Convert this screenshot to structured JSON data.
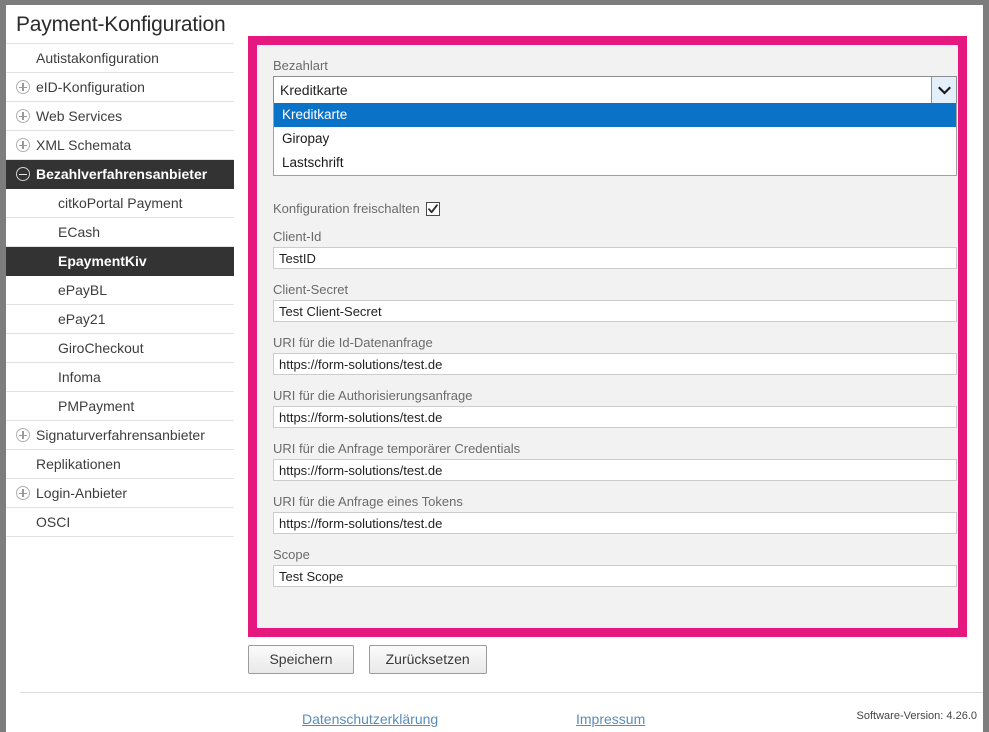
{
  "page": {
    "title": "Payment-Konfiguration"
  },
  "sidebar": {
    "items": [
      {
        "label": "Autistakonfiguration",
        "level": 0,
        "toggle": "none",
        "selected": false
      },
      {
        "label": "eID-Konfiguration",
        "level": 0,
        "toggle": "plus",
        "selected": false
      },
      {
        "label": "Web Services",
        "level": 0,
        "toggle": "plus",
        "selected": false
      },
      {
        "label": "XML Schemata",
        "level": 0,
        "toggle": "plus",
        "selected": false
      },
      {
        "label": "Bezahlverfahrensanbieter",
        "level": 0,
        "toggle": "minus",
        "selected": true
      },
      {
        "label": "citkoPortal Payment",
        "level": 1,
        "toggle": "none",
        "selected": false
      },
      {
        "label": "ECash",
        "level": 1,
        "toggle": "none",
        "selected": false
      },
      {
        "label": "EpaymentKiv",
        "level": 1,
        "toggle": "none",
        "selected": true
      },
      {
        "label": "ePayBL",
        "level": 1,
        "toggle": "none",
        "selected": false
      },
      {
        "label": "ePay21",
        "level": 1,
        "toggle": "none",
        "selected": false
      },
      {
        "label": "GiroCheckout",
        "level": 1,
        "toggle": "none",
        "selected": false
      },
      {
        "label": "Infoma",
        "level": 1,
        "toggle": "none",
        "selected": false
      },
      {
        "label": "PMPayment",
        "level": 1,
        "toggle": "none",
        "selected": false
      },
      {
        "label": "Signaturverfahrensanbieter",
        "level": 0,
        "toggle": "plus",
        "selected": false
      },
      {
        "label": "Replikationen",
        "level": 0,
        "toggle": "none",
        "selected": false
      },
      {
        "label": "Login-Anbieter",
        "level": 0,
        "toggle": "plus",
        "selected": false
      },
      {
        "label": "OSCI",
        "level": 0,
        "toggle": "none",
        "selected": false
      }
    ]
  },
  "form": {
    "payment_type": {
      "label": "Bezahlart",
      "selected": "Kreditkarte",
      "expanded": true,
      "options": [
        {
          "label": "Kreditkarte",
          "highlighted": true
        },
        {
          "label": "Giropay",
          "highlighted": false
        },
        {
          "label": "Lastschrift",
          "highlighted": false
        }
      ]
    },
    "enable_config": {
      "label": "Konfiguration freischalten",
      "checked": true
    },
    "fields": [
      {
        "label": "Client-Id",
        "value": "TestID"
      },
      {
        "label": "Client-Secret",
        "value": "Test Client-Secret"
      },
      {
        "label": "URI für die Id-Datenanfrage",
        "value": "https://form-solutions/test.de"
      },
      {
        "label": "URI für die Authorisierungsanfrage",
        "value": "https://form-solutions/test.de"
      },
      {
        "label": "URI für die Anfrage temporärer Credentials",
        "value": "https://form-solutions/test.de"
      },
      {
        "label": "URI für die Anfrage eines Tokens",
        "value": "https://form-solutions/test.de"
      },
      {
        "label": "Scope",
        "value": "Test Scope"
      }
    ]
  },
  "buttons": {
    "save": "Speichern",
    "reset": "Zurücksetzen"
  },
  "footer": {
    "privacy_link": "Datenschutzerklärung",
    "imprint_link": "Impressum",
    "version": "Software-Version: 4.26.0"
  },
  "colors": {
    "highlight_border": "#e4187f",
    "option_highlight": "#0a73c8",
    "selected_nav": "#333333",
    "link": "#5b8cb8"
  }
}
